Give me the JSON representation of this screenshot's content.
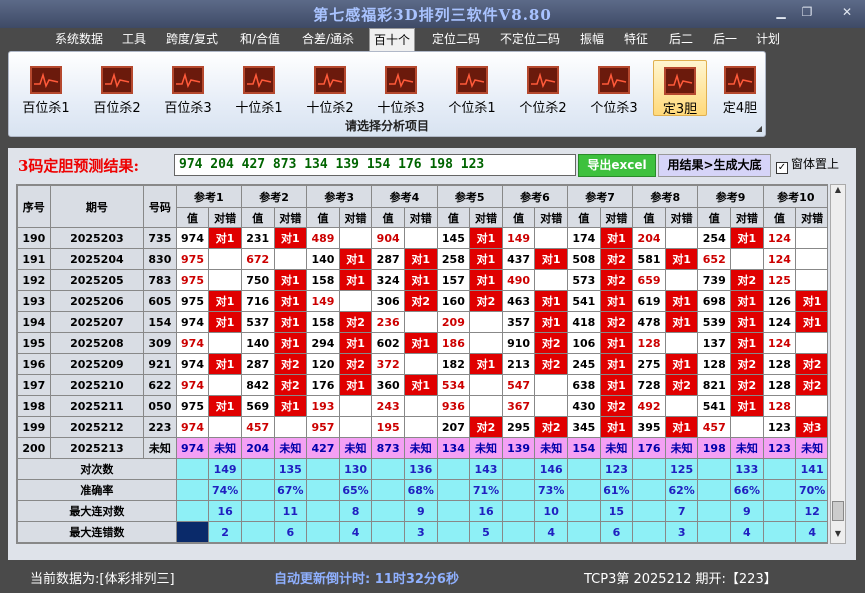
{
  "window": {
    "title": "第七感福彩3D排列三软件V8.80",
    "min_icon": "minimize-icon",
    "max_icon": "maximize-icon",
    "close_icon": "close-icon"
  },
  "menu": [
    "系统数据",
    "工具",
    "跨度/复式",
    "和/合值",
    "合差/通杀",
    "百十个",
    "定位二码",
    "不定位二码",
    "振幅",
    "特征",
    "后二",
    "后一",
    "计划"
  ],
  "menu_active": 5,
  "ribbon": {
    "buttons": [
      "百位杀1",
      "百位杀2",
      "百位杀3",
      "十位杀1",
      "十位杀2",
      "十位杀3",
      "个位杀1",
      "个位杀2",
      "个位杀3",
      "定3胆",
      "定4胆"
    ],
    "selected": 9,
    "icon": "chart-icon",
    "caption": "请选择分析项目"
  },
  "prediction": {
    "label": "3码定胆预测结果:",
    "value": "974 204 427 873 134 139 154 176 198 123"
  },
  "buttons": {
    "excel": "导出excel",
    "generate": "用结果>生成大底"
  },
  "ontop": {
    "checked": "✓",
    "label": "窗体置上"
  },
  "table": {
    "head_fixed": [
      "序号",
      "期号",
      "号码"
    ],
    "groups": [
      "参考1",
      "参考2",
      "参考3",
      "参考4",
      "参考5",
      "参考6",
      "参考7",
      "参考8",
      "参考9",
      "参考10"
    ],
    "sub": [
      "值",
      "对错"
    ],
    "rows": [
      {
        "seq": "190",
        "issue": "2025203",
        "num": "735",
        "cells": [
          [
            "974",
            "对1"
          ],
          [
            "231",
            "对1"
          ],
          [
            "489",
            ""
          ],
          [
            "904",
            ""
          ],
          [
            "145",
            "对1"
          ],
          [
            "149",
            ""
          ],
          [
            "174",
            "对1"
          ],
          [
            "204",
            ""
          ],
          [
            "254",
            "对1"
          ],
          [
            "124",
            ""
          ]
        ]
      },
      {
        "seq": "191",
        "issue": "2025204",
        "num": "830",
        "cells": [
          [
            "975",
            ""
          ],
          [
            "672",
            ""
          ],
          [
            "140",
            "对1"
          ],
          [
            "287",
            "对1"
          ],
          [
            "258",
            "对1"
          ],
          [
            "437",
            "对1"
          ],
          [
            "508",
            "对2"
          ],
          [
            "581",
            "对1"
          ],
          [
            "652",
            ""
          ],
          [
            "124",
            ""
          ]
        ]
      },
      {
        "seq": "192",
        "issue": "2025205",
        "num": "783",
        "cells": [
          [
            "975",
            ""
          ],
          [
            "750",
            "对1"
          ],
          [
            "158",
            "对1"
          ],
          [
            "324",
            "对1"
          ],
          [
            "157",
            "对1"
          ],
          [
            "490",
            ""
          ],
          [
            "573",
            "对2"
          ],
          [
            "659",
            ""
          ],
          [
            "739",
            "对2"
          ],
          [
            "125",
            ""
          ]
        ]
      },
      {
        "seq": "193",
        "issue": "2025206",
        "num": "605",
        "cells": [
          [
            "975",
            "对1"
          ],
          [
            "716",
            "对1"
          ],
          [
            "149",
            ""
          ],
          [
            "306",
            "对2"
          ],
          [
            "160",
            "对2"
          ],
          [
            "463",
            "对1"
          ],
          [
            "541",
            "对1"
          ],
          [
            "619",
            "对1"
          ],
          [
            "698",
            "对1"
          ],
          [
            "126",
            "对1"
          ]
        ]
      },
      {
        "seq": "194",
        "issue": "2025207",
        "num": "154",
        "cells": [
          [
            "974",
            "对1"
          ],
          [
            "537",
            "对1"
          ],
          [
            "158",
            "对2"
          ],
          [
            "236",
            ""
          ],
          [
            "209",
            ""
          ],
          [
            "357",
            "对1"
          ],
          [
            "418",
            "对2"
          ],
          [
            "478",
            "对1"
          ],
          [
            "539",
            "对1"
          ],
          [
            "124",
            "对1"
          ]
        ]
      },
      {
        "seq": "195",
        "issue": "2025208",
        "num": "309",
        "cells": [
          [
            "974",
            ""
          ],
          [
            "140",
            "对1"
          ],
          [
            "294",
            "对1"
          ],
          [
            "602",
            "对1"
          ],
          [
            "186",
            ""
          ],
          [
            "910",
            "对2"
          ],
          [
            "106",
            "对1"
          ],
          [
            "128",
            ""
          ],
          [
            "137",
            "对1"
          ],
          [
            "124",
            ""
          ]
        ]
      },
      {
        "seq": "196",
        "issue": "2025209",
        "num": "921",
        "cells": [
          [
            "974",
            "对1"
          ],
          [
            "287",
            "对2"
          ],
          [
            "120",
            "对2"
          ],
          [
            "372",
            ""
          ],
          [
            "182",
            "对1"
          ],
          [
            "213",
            "对2"
          ],
          [
            "245",
            "对1"
          ],
          [
            "275",
            "对1"
          ],
          [
            "128",
            "对2"
          ],
          [
            "128",
            "对2"
          ]
        ]
      },
      {
        "seq": "197",
        "issue": "2025210",
        "num": "622",
        "cells": [
          [
            "974",
            ""
          ],
          [
            "842",
            "对2"
          ],
          [
            "176",
            "对1"
          ],
          [
            "360",
            "对1"
          ],
          [
            "534",
            ""
          ],
          [
            "547",
            ""
          ],
          [
            "638",
            "对1"
          ],
          [
            "728",
            "对2"
          ],
          [
            "821",
            "对2"
          ],
          [
            "128",
            "对2"
          ]
        ]
      },
      {
        "seq": "198",
        "issue": "2025211",
        "num": "050",
        "cells": [
          [
            "975",
            "对1"
          ],
          [
            "569",
            "对1"
          ],
          [
            "193",
            ""
          ],
          [
            "243",
            ""
          ],
          [
            "936",
            ""
          ],
          [
            "367",
            ""
          ],
          [
            "430",
            "对2"
          ],
          [
            "492",
            ""
          ],
          [
            "541",
            "对1"
          ],
          [
            "128",
            ""
          ]
        ]
      },
      {
        "seq": "199",
        "issue": "2025212",
        "num": "223",
        "cells": [
          [
            "974",
            ""
          ],
          [
            "457",
            ""
          ],
          [
            "957",
            ""
          ],
          [
            "195",
            ""
          ],
          [
            "207",
            "对2"
          ],
          [
            "295",
            "对2"
          ],
          [
            "345",
            "对1"
          ],
          [
            "395",
            "对1"
          ],
          [
            "457",
            ""
          ],
          [
            "123",
            "对3"
          ]
        ]
      }
    ],
    "last_row": {
      "seq": "200",
      "issue": "2025213",
      "num": "未知",
      "cells": [
        [
          "974",
          "未知"
        ],
        [
          "204",
          "未知"
        ],
        [
          "427",
          "未知"
        ],
        [
          "873",
          "未知"
        ],
        [
          "134",
          "未知"
        ],
        [
          "139",
          "未知"
        ],
        [
          "154",
          "未知"
        ],
        [
          "176",
          "未知"
        ],
        [
          "198",
          "未知"
        ],
        [
          "123",
          "未知"
        ]
      ]
    },
    "stats": [
      {
        "label": "对次数",
        "values": [
          "149",
          "135",
          "130",
          "136",
          "143",
          "146",
          "123",
          "125",
          "133",
          "141"
        ]
      },
      {
        "label": "准确率",
        "values": [
          "74%",
          "67%",
          "65%",
          "68%",
          "71%",
          "73%",
          "61%",
          "62%",
          "66%",
          "70%"
        ]
      },
      {
        "label": "最大连对数",
        "values": [
          "16",
          "11",
          "8",
          "9",
          "16",
          "10",
          "15",
          "7",
          "9",
          "12"
        ]
      },
      {
        "label": "最大连错数",
        "values": [
          "2",
          "6",
          "4",
          "3",
          "5",
          "4",
          "6",
          "3",
          "4",
          "4"
        ]
      }
    ]
  },
  "status": {
    "left": "当前数据为:[体彩排列三]",
    "mid": "自动更新倒计时:  11时32分6秒",
    "right": "TCP3第  2025212  期开:【223】"
  }
}
